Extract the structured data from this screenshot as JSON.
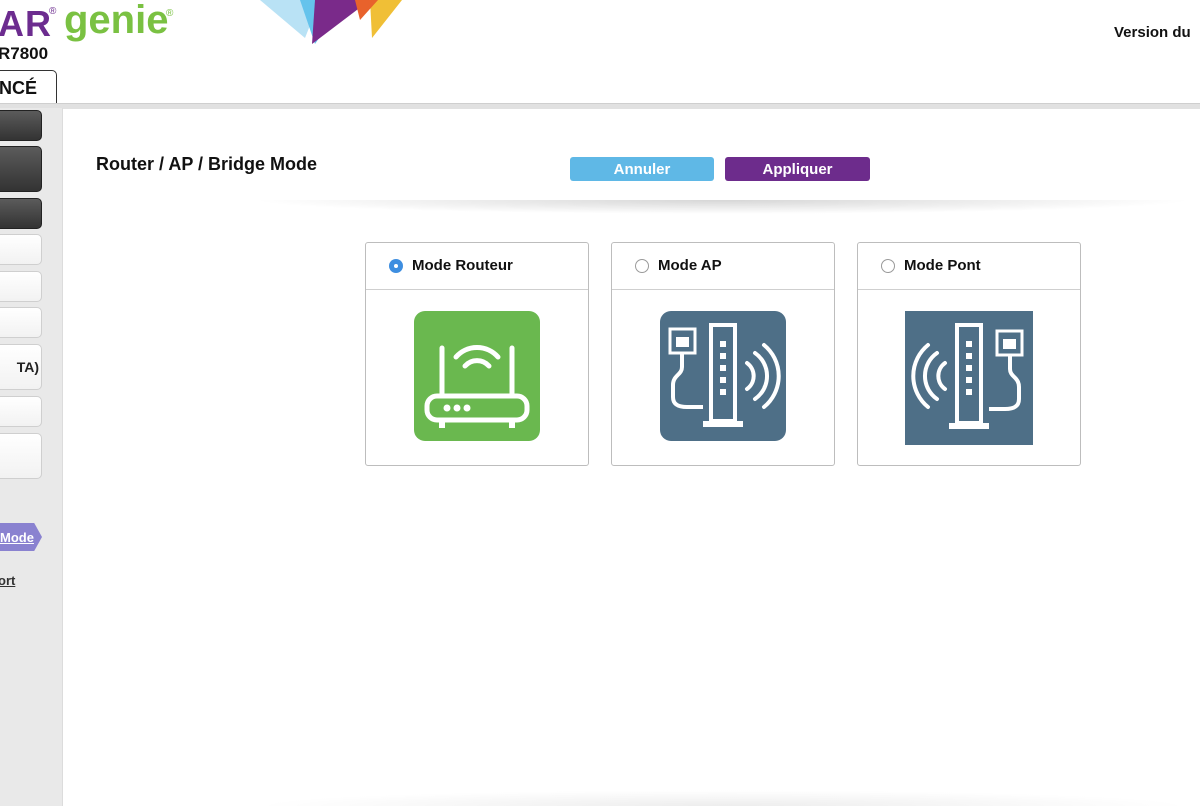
{
  "header": {
    "brand": "AR",
    "registered_mark": "®",
    "product": "genie",
    "model": "R7800",
    "version_label": "Version du",
    "tab_label": "NCÉ"
  },
  "sidebar": {
    "items": [
      {
        "style": "dark",
        "label": ""
      },
      {
        "style": "dark",
        "label": ""
      },
      {
        "style": "dark",
        "label": ""
      },
      {
        "style": "light",
        "label": ""
      },
      {
        "style": "light",
        "label": ""
      },
      {
        "style": "light",
        "label": ""
      },
      {
        "style": "light",
        "label": "TA)"
      },
      {
        "style": "light",
        "label": ""
      },
      {
        "style": "light",
        "label": ""
      }
    ],
    "active_label": "Mode",
    "link_label": "ort"
  },
  "main": {
    "title": "Router / AP / Bridge Mode",
    "cancel_label": "Annuler",
    "apply_label": "Appliquer",
    "modes": [
      {
        "label": "Mode Routeur",
        "selected": true,
        "icon": "router-icon",
        "color": "#6ab84f"
      },
      {
        "label": "Mode AP",
        "selected": false,
        "icon": "access-point-icon",
        "color": "#4e6f87"
      },
      {
        "label": "Mode Pont",
        "selected": false,
        "icon": "bridge-icon",
        "color": "#4e6f87"
      }
    ]
  },
  "colors": {
    "brand_purple": "#6c2c8f",
    "genie_green": "#7ac142",
    "cancel_blue": "#5fb8e6",
    "apply_purple": "#6d2c8c",
    "radio_selected": "#3e8ee0",
    "active_nav": "#8a82d0"
  }
}
